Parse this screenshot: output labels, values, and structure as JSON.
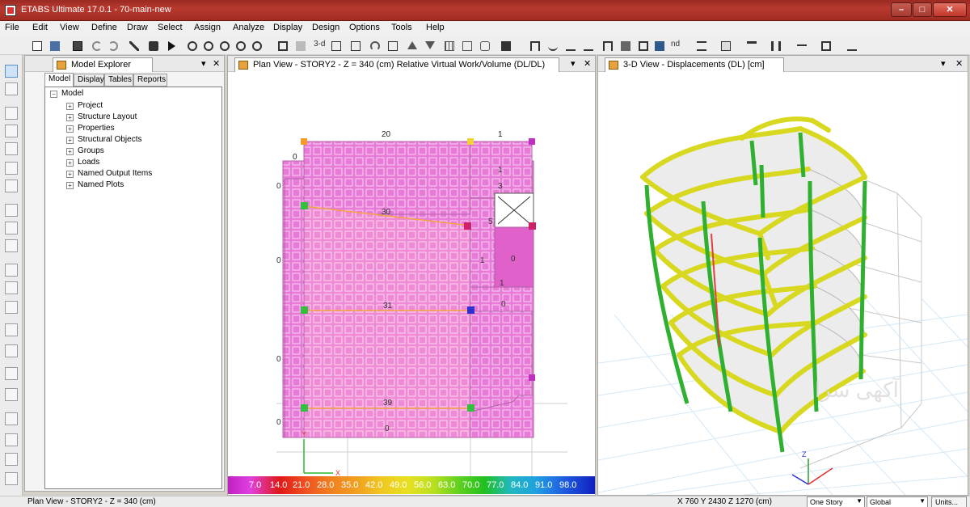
{
  "window": {
    "title": "ETABS Ultimate 17.0.1 - 70-main-new",
    "min_label": "–",
    "max_label": "□",
    "close_label": "✕"
  },
  "menu": [
    "File",
    "Edit",
    "View",
    "Define",
    "Draw",
    "Select",
    "Assign",
    "Analyze",
    "Display",
    "Design",
    "Options",
    "Tools",
    "Help"
  ],
  "toolbar": {
    "text_3d": "3-d",
    "text_nd": "nd"
  },
  "explorer": {
    "title": "Model Explorer",
    "pin": "▾",
    "close": "✕",
    "tabs": [
      "Model",
      "Display",
      "Tables",
      "Reports"
    ],
    "root": "Model",
    "items": [
      "Project",
      "Structure Layout",
      "Properties",
      "Structural Objects",
      "Groups",
      "Loads",
      "Named Output Items",
      "Named Plots"
    ]
  },
  "plan": {
    "title": "Plan View - STORY2 - Z = 340 (cm)  Relative Virtual Work/Volume (DL/DL)",
    "pin": "▾",
    "close": "✕",
    "grid_top": [
      "20",
      "1"
    ],
    "labels": [
      "0",
      "30",
      "31",
      "39",
      "5",
      "1",
      "3",
      "0",
      "0",
      "0",
      "0",
      "0",
      "1",
      "1",
      "0",
      "0"
    ],
    "axis_x": "X",
    "axis_y": "Y",
    "colorbar": [
      "7.0",
      "14.0",
      "21.0",
      "28.0",
      "35.0",
      "42.0",
      "49.0",
      "56.0",
      "63.0",
      "70.0",
      "77.0",
      "84.0",
      "91.0",
      "98.0"
    ]
  },
  "view3d": {
    "title": "3-D View  - Displacements (DL)  [cm]",
    "pin": "▾",
    "close": "✕",
    "watermark": "آکهی سرا"
  },
  "status": {
    "left": "Plan View - STORY2 - Z = 340 (cm)",
    "coords": "X 760  Y 2430  Z 1270 (cm)",
    "story_select": "One Story",
    "coord_select": "Global",
    "units_button": "Units..."
  }
}
